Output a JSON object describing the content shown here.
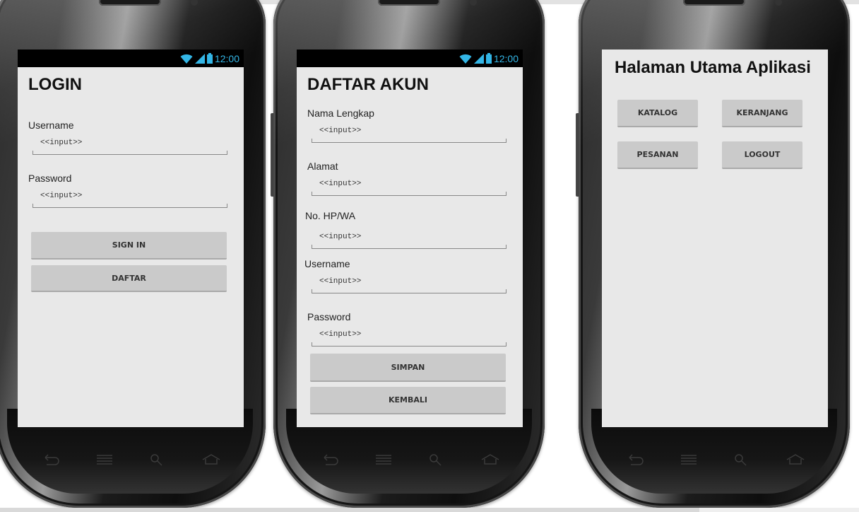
{
  "status_bar": {
    "time": "12:00"
  },
  "login_screen": {
    "title": "LOGIN",
    "username_label": "Username",
    "username_value": "<<input>>",
    "password_label": "Password",
    "password_value": "<<input>>",
    "signin_button": "SIGN IN",
    "daftar_button": "DAFTAR"
  },
  "register_screen": {
    "title": "DAFTAR AKUN",
    "fields": [
      {
        "label": "Nama Lengkap",
        "value": "<<input>>"
      },
      {
        "label": "Alamat",
        "value": "<<input>>"
      },
      {
        "label": "No. HP/WA",
        "value": "<<input>>"
      },
      {
        "label": "Username",
        "value": "<<input>>"
      },
      {
        "label": "Password",
        "value": "<<input>>"
      }
    ],
    "simpan_button": "SIMPAN",
    "kembali_button": "KEMBALI"
  },
  "main_screen": {
    "title": "Halaman Utama Aplikasi",
    "buttons": [
      "KATALOG",
      "KERANJANG",
      "PESANAN",
      "LOGOUT"
    ]
  },
  "colors": {
    "accent": "#33b5e5",
    "screen_bg": "#e8e8e8",
    "button_bg": "#cacaca"
  },
  "icons": [
    "wifi-icon",
    "signal-icon",
    "battery-icon",
    "back-icon",
    "menu-icon",
    "search-icon",
    "home-icon"
  ]
}
